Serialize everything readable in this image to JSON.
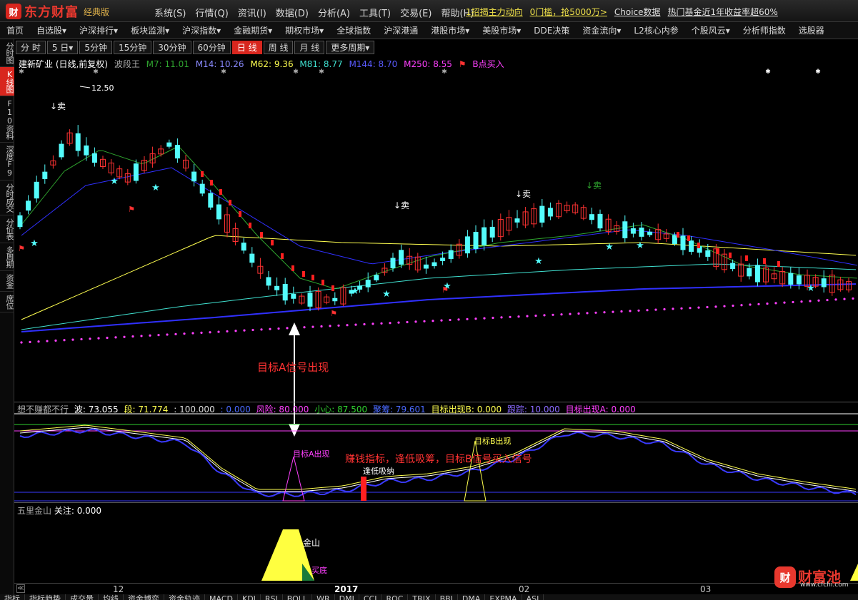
{
  "app": {
    "logo_mark": "财",
    "title": "东方财富",
    "edition": "经典版"
  },
  "menu": [
    "系统(S)",
    "行情(Q)",
    "资讯(I)",
    "数据(D)",
    "分析(A)",
    "工具(T)",
    "交易(E)",
    "帮助(H)"
  ],
  "promos": [
    "1招揭主力动向",
    "0门槛，抢5000万>",
    "Choice数据",
    "热门基金近1年收益率超60%"
  ],
  "nav": [
    "首页",
    "自选股▾",
    "沪深排行▾",
    "板块监测▾",
    "沪深指数▾",
    "金融期货▾",
    "期权市场▾",
    "全球指数",
    "沪深港通",
    "港股市场▾",
    "美股市场▾",
    "DDE决策",
    "资金流向▾",
    "L2核心内参",
    "个股风云▾",
    "分析师指数",
    "选股器"
  ],
  "sidebar": [
    "分时图",
    "K线图",
    "F10资料",
    "深度F9",
    "分时成交",
    "分价表",
    "多周期",
    "资金",
    "席位"
  ],
  "periods": [
    "分 时",
    "5 日▾",
    "5分钟",
    "15分钟",
    "30分钟",
    "60分钟",
    "日 线",
    "周 线",
    "月 线",
    "更多周期▾"
  ],
  "active_period": "日 线",
  "legend": {
    "name": "建新矿业 (日线,前复权)",
    "indicator": "波段王",
    "m7": "M7: 11.01",
    "m14": "M14: 10.26",
    "m62": "M62: 9.36",
    "m81": "M81: 8.77",
    "m144": "M144: 8.70",
    "m250": "M250: 8.55",
    "bpoint": "B点买入"
  },
  "chart": {
    "high_label": "12.50",
    "sell1": "↓卖",
    "sell2": "↓卖",
    "sell3": "↓卖",
    "sell4": "↓卖"
  },
  "annotations": {
    "target_a": "目标A信号出现",
    "mid_text": "赚钱指标，逢低吸筹，目标B信号买入信号",
    "target_a_out": "目标A出现",
    "target_b_out": "目标B出现",
    "low_buy": "逢低吸纳",
    "jinshan": "金山",
    "maidi": "买底"
  },
  "indicator": {
    "name": "想不赚都不行",
    "wave": "波: 73.055",
    "segment": "段: 71.774",
    "v1": ": 100.000",
    "v2": ": 0.000",
    "risk": "风险: 80.000",
    "careful": "小心: 87.500",
    "accum": "聚筹: 79.601",
    "targetB": "目标出现B: 0.000",
    "track": "跟踪: 10.000",
    "targetA": "目标出现A: 0.000"
  },
  "kd": {
    "name": "五里金山",
    "focus": "关注: 0.000"
  },
  "xaxis": {
    "labels": [
      "12",
      "2017",
      "02",
      "03"
    ]
  },
  "tabs": [
    "指标",
    "指标趋势",
    "成交量",
    "均线",
    "资金博弈",
    "资金轨迹",
    "MACD",
    "KDJ",
    "RSI",
    "BOLL",
    "WR",
    "DMI",
    "CCI",
    "ROC",
    "TRIX",
    "BBI",
    "DMA",
    "EXPMA",
    "ASI"
  ],
  "watermark": {
    "icon": "财",
    "text": "财富池",
    "url": "www.cfchi.com"
  },
  "colors": {
    "up": "#ff3232",
    "down": "#54fcfc",
    "m7": "#2fa52f",
    "m14": "#ffffff",
    "m62": "#ffff50",
    "m81": "#40e0d0",
    "m144": "#3030ff",
    "m250": "#ff40ff"
  }
}
